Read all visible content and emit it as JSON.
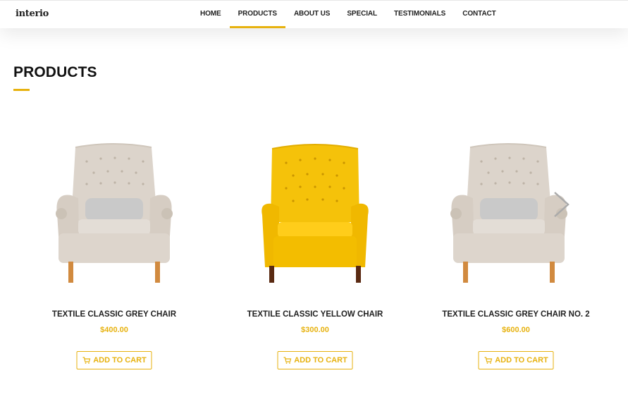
{
  "brand": {
    "logo_text": "interio"
  },
  "nav": {
    "items": [
      {
        "label": "HOME",
        "active": false
      },
      {
        "label": "PRODUCTS",
        "active": true
      },
      {
        "label": "ABOUT US",
        "active": false
      },
      {
        "label": "SPECIAL",
        "active": false
      },
      {
        "label": "TESTIMONIALS",
        "active": false
      },
      {
        "label": "CONTACT",
        "active": false
      }
    ]
  },
  "section": {
    "title": "PRODUCTS"
  },
  "products": [
    {
      "name": "TEXTILE CLASSIC GREY CHAIR",
      "price": "$400.00",
      "button_label": "ADD TO CART",
      "image": "grey-armchair"
    },
    {
      "name": "TEXTILE CLASSIC YELLOW CHAIR",
      "price": "$300.00",
      "button_label": "ADD TO CART",
      "image": "yellow-armchair"
    },
    {
      "name": "TEXTILE CLASSIC GREY CHAIR NO. 2",
      "price": "$600.00",
      "button_label": "ADD TO CART",
      "image": "grey-armchair"
    }
  ],
  "carousel": {
    "next_icon": "chevron-right-icon"
  },
  "colors": {
    "accent": "#e7b20f",
    "text": "#222222",
    "grey_chair": "#dcd4cb",
    "yellow_chair": "#f5c20a"
  }
}
